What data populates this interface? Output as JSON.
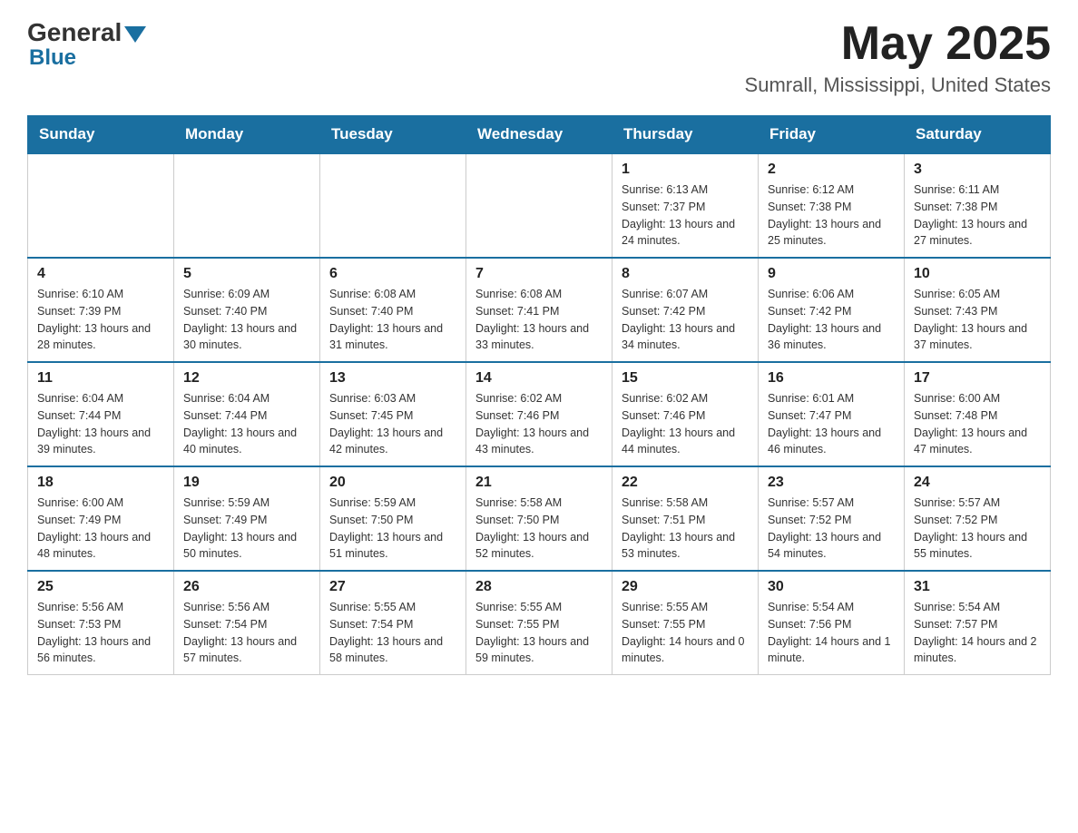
{
  "header": {
    "logo_general": "General",
    "logo_blue": "Blue",
    "month_year": "May 2025",
    "location": "Sumrall, Mississippi, United States"
  },
  "calendar": {
    "days_of_week": [
      "Sunday",
      "Monday",
      "Tuesday",
      "Wednesday",
      "Thursday",
      "Friday",
      "Saturday"
    ],
    "weeks": [
      [
        {
          "day": "",
          "info": ""
        },
        {
          "day": "",
          "info": ""
        },
        {
          "day": "",
          "info": ""
        },
        {
          "day": "",
          "info": ""
        },
        {
          "day": "1",
          "info": "Sunrise: 6:13 AM\nSunset: 7:37 PM\nDaylight: 13 hours and 24 minutes."
        },
        {
          "day": "2",
          "info": "Sunrise: 6:12 AM\nSunset: 7:38 PM\nDaylight: 13 hours and 25 minutes."
        },
        {
          "day": "3",
          "info": "Sunrise: 6:11 AM\nSunset: 7:38 PM\nDaylight: 13 hours and 27 minutes."
        }
      ],
      [
        {
          "day": "4",
          "info": "Sunrise: 6:10 AM\nSunset: 7:39 PM\nDaylight: 13 hours and 28 minutes."
        },
        {
          "day": "5",
          "info": "Sunrise: 6:09 AM\nSunset: 7:40 PM\nDaylight: 13 hours and 30 minutes."
        },
        {
          "day": "6",
          "info": "Sunrise: 6:08 AM\nSunset: 7:40 PM\nDaylight: 13 hours and 31 minutes."
        },
        {
          "day": "7",
          "info": "Sunrise: 6:08 AM\nSunset: 7:41 PM\nDaylight: 13 hours and 33 minutes."
        },
        {
          "day": "8",
          "info": "Sunrise: 6:07 AM\nSunset: 7:42 PM\nDaylight: 13 hours and 34 minutes."
        },
        {
          "day": "9",
          "info": "Sunrise: 6:06 AM\nSunset: 7:42 PM\nDaylight: 13 hours and 36 minutes."
        },
        {
          "day": "10",
          "info": "Sunrise: 6:05 AM\nSunset: 7:43 PM\nDaylight: 13 hours and 37 minutes."
        }
      ],
      [
        {
          "day": "11",
          "info": "Sunrise: 6:04 AM\nSunset: 7:44 PM\nDaylight: 13 hours and 39 minutes."
        },
        {
          "day": "12",
          "info": "Sunrise: 6:04 AM\nSunset: 7:44 PM\nDaylight: 13 hours and 40 minutes."
        },
        {
          "day": "13",
          "info": "Sunrise: 6:03 AM\nSunset: 7:45 PM\nDaylight: 13 hours and 42 minutes."
        },
        {
          "day": "14",
          "info": "Sunrise: 6:02 AM\nSunset: 7:46 PM\nDaylight: 13 hours and 43 minutes."
        },
        {
          "day": "15",
          "info": "Sunrise: 6:02 AM\nSunset: 7:46 PM\nDaylight: 13 hours and 44 minutes."
        },
        {
          "day": "16",
          "info": "Sunrise: 6:01 AM\nSunset: 7:47 PM\nDaylight: 13 hours and 46 minutes."
        },
        {
          "day": "17",
          "info": "Sunrise: 6:00 AM\nSunset: 7:48 PM\nDaylight: 13 hours and 47 minutes."
        }
      ],
      [
        {
          "day": "18",
          "info": "Sunrise: 6:00 AM\nSunset: 7:49 PM\nDaylight: 13 hours and 48 minutes."
        },
        {
          "day": "19",
          "info": "Sunrise: 5:59 AM\nSunset: 7:49 PM\nDaylight: 13 hours and 50 minutes."
        },
        {
          "day": "20",
          "info": "Sunrise: 5:59 AM\nSunset: 7:50 PM\nDaylight: 13 hours and 51 minutes."
        },
        {
          "day": "21",
          "info": "Sunrise: 5:58 AM\nSunset: 7:50 PM\nDaylight: 13 hours and 52 minutes."
        },
        {
          "day": "22",
          "info": "Sunrise: 5:58 AM\nSunset: 7:51 PM\nDaylight: 13 hours and 53 minutes."
        },
        {
          "day": "23",
          "info": "Sunrise: 5:57 AM\nSunset: 7:52 PM\nDaylight: 13 hours and 54 minutes."
        },
        {
          "day": "24",
          "info": "Sunrise: 5:57 AM\nSunset: 7:52 PM\nDaylight: 13 hours and 55 minutes."
        }
      ],
      [
        {
          "day": "25",
          "info": "Sunrise: 5:56 AM\nSunset: 7:53 PM\nDaylight: 13 hours and 56 minutes."
        },
        {
          "day": "26",
          "info": "Sunrise: 5:56 AM\nSunset: 7:54 PM\nDaylight: 13 hours and 57 minutes."
        },
        {
          "day": "27",
          "info": "Sunrise: 5:55 AM\nSunset: 7:54 PM\nDaylight: 13 hours and 58 minutes."
        },
        {
          "day": "28",
          "info": "Sunrise: 5:55 AM\nSunset: 7:55 PM\nDaylight: 13 hours and 59 minutes."
        },
        {
          "day": "29",
          "info": "Sunrise: 5:55 AM\nSunset: 7:55 PM\nDaylight: 14 hours and 0 minutes."
        },
        {
          "day": "30",
          "info": "Sunrise: 5:54 AM\nSunset: 7:56 PM\nDaylight: 14 hours and 1 minute."
        },
        {
          "day": "31",
          "info": "Sunrise: 5:54 AM\nSunset: 7:57 PM\nDaylight: 14 hours and 2 minutes."
        }
      ]
    ]
  }
}
